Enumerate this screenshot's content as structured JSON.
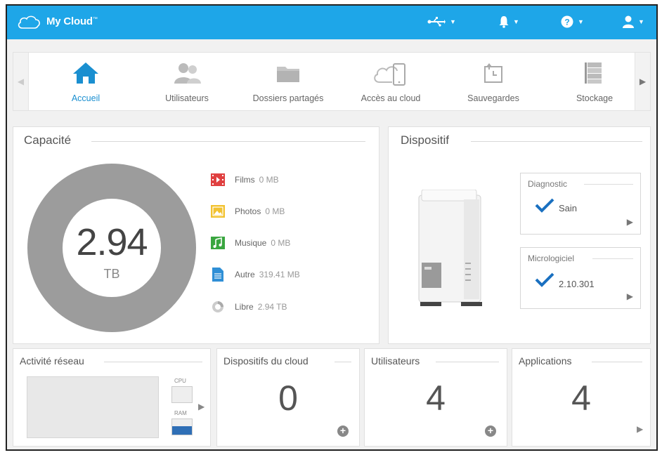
{
  "header": {
    "brand": "My Cloud",
    "brand_mark": "™",
    "icons": [
      "usb-icon",
      "bell-icon",
      "help-icon",
      "user-icon"
    ],
    "accent": "#1ea6e8"
  },
  "nav": {
    "items": [
      {
        "label": "Accueil",
        "icon": "home-icon",
        "active": true
      },
      {
        "label": "Utilisateurs",
        "icon": "users-icon"
      },
      {
        "label": "Dossiers partagés",
        "icon": "folder-icon"
      },
      {
        "label": "Accès au cloud",
        "icon": "cloud-phone-icon"
      },
      {
        "label": "Sauvegardes",
        "icon": "backup-icon"
      },
      {
        "label": "Stockage",
        "icon": "storage-icon"
      }
    ],
    "active_color": "#1a8fd0"
  },
  "capacity": {
    "title": "Capacité",
    "value": "2.94",
    "unit": "TB",
    "legend": [
      {
        "label": "Films",
        "value": "0 MB",
        "color": "#e04040"
      },
      {
        "label": "Photos",
        "value": "0 MB",
        "color": "#f2c230"
      },
      {
        "label": "Musique",
        "value": "0 MB",
        "color": "#3aa640"
      },
      {
        "label": "Autre",
        "value": "319.41 MB",
        "color": "#2f8fd6"
      },
      {
        "label": "Libre",
        "value": "2.94 TB",
        "color": "#aaaaaa"
      }
    ],
    "ring_color": "#9c9c9c"
  },
  "device": {
    "title": "Dispositif",
    "diagnostic": {
      "title": "Diagnostic",
      "value": "Sain"
    },
    "firmware": {
      "title": "Micrologiciel",
      "value": "2.10.301"
    },
    "check_color": "#1a70c0"
  },
  "network": {
    "title": "Activité réseau",
    "cpu_label": "CPU",
    "ram_label": "RAM"
  },
  "cloud_devices": {
    "title": "Dispositifs du cloud",
    "count": "0"
  },
  "users": {
    "title": "Utilisateurs",
    "count": "4"
  },
  "apps": {
    "title": "Applications",
    "count": "4"
  }
}
